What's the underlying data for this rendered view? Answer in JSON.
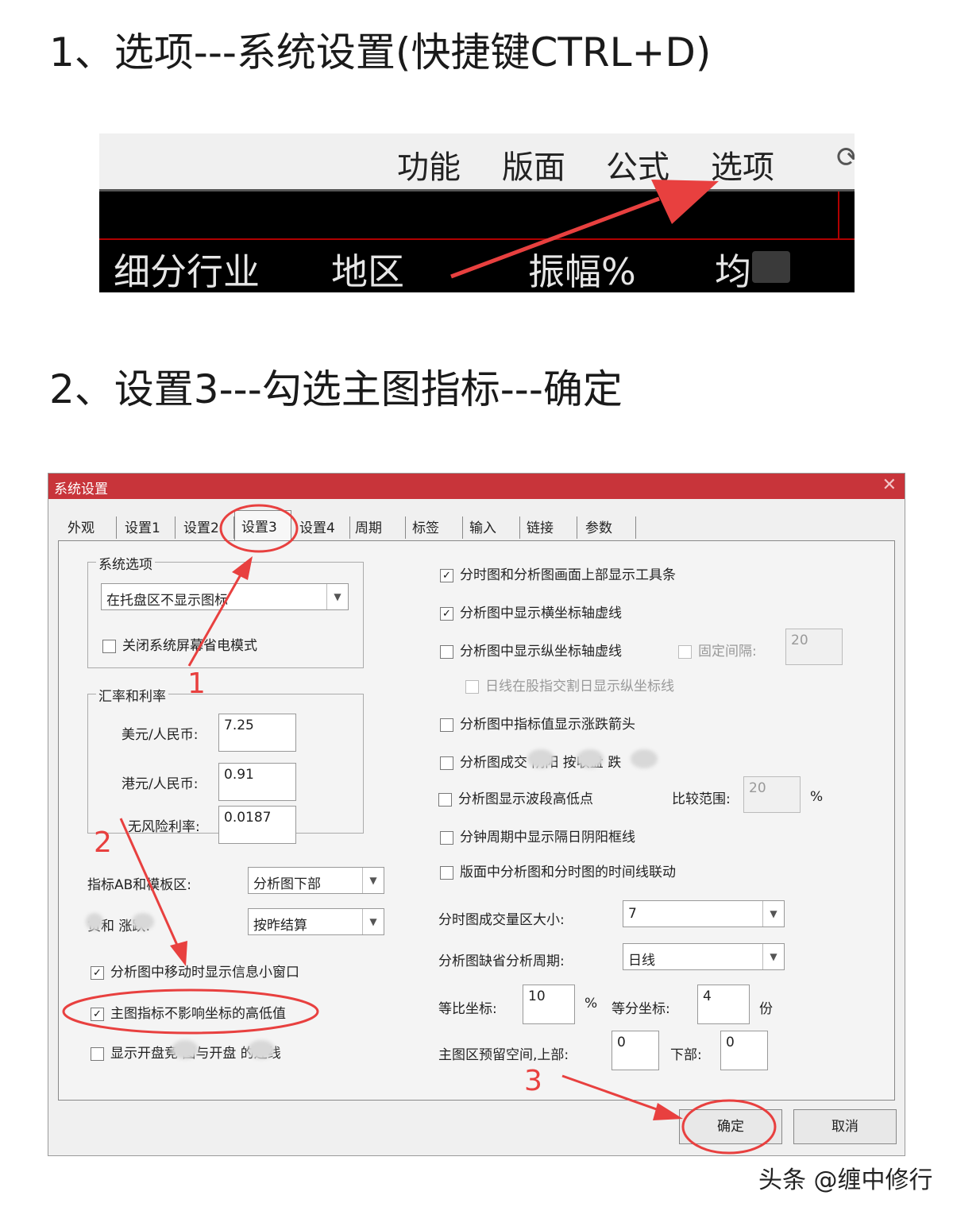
{
  "steps": {
    "step1": "1、选项---系统设置(快捷键CTRL+D)",
    "step2": "2、设置3---勾选主图指标---确定"
  },
  "menubar": {
    "items": [
      "功能",
      "版面",
      "公式",
      "选项"
    ],
    "refresh_icon": "refresh-icon",
    "columns": [
      "细分行业",
      "地区",
      "振幅%",
      "均"
    ]
  },
  "dialog": {
    "title": "系统设置",
    "close_icon": "close-icon",
    "tabs": [
      "外观",
      "设置1",
      "设置2",
      "设置3",
      "设置4",
      "周期",
      "标签",
      "输入",
      "链接",
      "参数"
    ],
    "active_tab": "设置3",
    "system_options": {
      "title": "系统选项",
      "combo_value": "在托盘区不显示图标",
      "checkbox": {
        "label": "关闭系统屏幕省电模式",
        "checked": false
      }
    },
    "rates": {
      "title": "汇率和利率",
      "usd_label": "美元/人民币:",
      "usd_value": "7.25",
      "hkd_label": "港元/人民币:",
      "hkd_value": "0.91",
      "rf_label": "无风险利率:",
      "rf_value": "0.0187"
    },
    "left_fields": {
      "ab_label": "指标AB和模板区:",
      "ab_value": "分析图下部",
      "futures_label": "货和  涨跌:",
      "futures_value": "按昨结算"
    },
    "left_checks": [
      {
        "label": "分析图中移动时显示信息小窗口",
        "checked": true
      },
      {
        "label": "主图指标不影响坐标的高低值",
        "checked": true
      },
      {
        "label": "显示开盘竞  图与开盘  的连线",
        "checked": false
      }
    ],
    "right_checks": {
      "c1": {
        "label": "分时图和分析图画面上部显示工具条",
        "checked": true
      },
      "c2": {
        "label": "分析图中显示横坐标轴虚线",
        "checked": true
      },
      "c3": {
        "label": "分析图中显示纵坐标轴虚线",
        "checked": false
      },
      "fixed_label": "固定间隔:",
      "fixed_value": "20",
      "c4": {
        "label": "日线在股指交割日显示纵坐标线",
        "checked": false
      },
      "c5": {
        "label": "分析图中指标值显示涨跌箭头",
        "checked": false
      },
      "c6": {
        "label": "分析图成交  阴阳  按收盘  跌",
        "checked": false
      },
      "c7": {
        "label": "分析图显示波段高低点",
        "checked": false
      },
      "compare_label": "比较范围:",
      "compare_value": "20",
      "pct": "%",
      "c8": {
        "label": "分钟周期中显示隔日阴阳框线",
        "checked": false
      },
      "c9": {
        "label": "版面中分析图和分时图的时间线联动",
        "checked": false
      }
    },
    "right_fields": {
      "vol_label": "分时图成交量区大小:",
      "vol_value": "7",
      "period_label": "分析图缺省分析周期:",
      "period_value": "日线",
      "ratio_label": "等比坐标:",
      "ratio_value": "10",
      "ratio_unit": "%",
      "equal_label": "等分坐标:",
      "equal_value": "4",
      "equal_unit": "份",
      "reserve_label": "主图区预留空间,上部:",
      "reserve_top": "0",
      "bottom_label": "下部:",
      "reserve_bottom": "0"
    },
    "buttons": {
      "ok": "确定",
      "cancel": "取消"
    }
  },
  "annotations": {
    "n1": "1",
    "n2": "2",
    "n3": "3",
    "color": "#e8403f"
  },
  "watermark": "头条 @缠中修行"
}
